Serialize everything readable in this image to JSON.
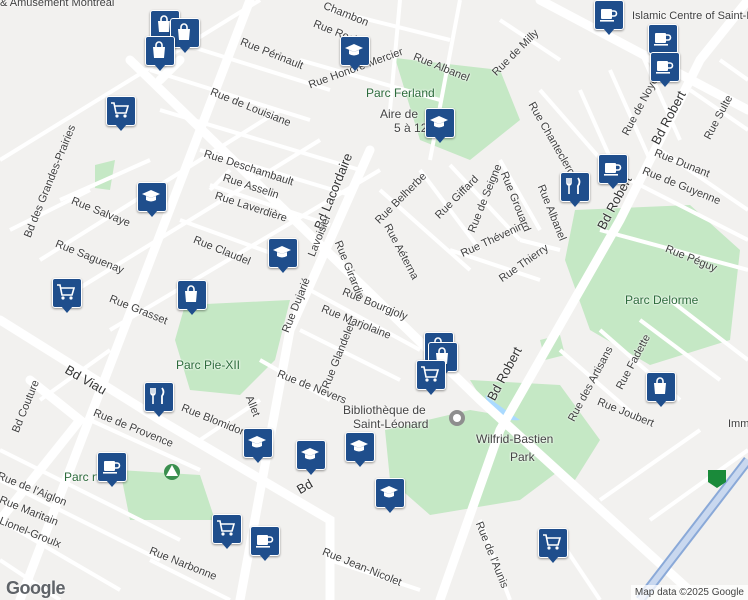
{
  "map": {
    "attribution": "Map data ©2025 Google",
    "logo": "Google",
    "colors": {
      "land": "#f2f1ef",
      "park": "#c5e8c5",
      "road": "#ffffff",
      "arterial": "#ffffff",
      "marker": "#1f4e8c",
      "water": "#aadaff"
    }
  },
  "labels": {
    "top_left_poi": "& Amusement Montreal",
    "islamic_centre": "Islamic Centre of Saint-Leonard",
    "rue_perinault": "Rue Périnault",
    "rue_roche": "Rue Roch",
    "rue_chambon": "Chambon",
    "rue_honore_mercier": "Rue Honoré-Mercier",
    "rue_albanel_top": "Rue Albanel",
    "rue_de_milly": "Rue de Milly",
    "parc_ferland": "Parc Ferland",
    "aire_de": "Aire de",
    "aire_ages": "5 à 12",
    "rue_de_louisiane": "Rue de Louisiane",
    "rue_deschambault": "Rue Deschambault",
    "rue_asselin": "Rue Asselin",
    "rue_laverdiere": "Rue Laverdière",
    "bd_lacordaire": "Bd Lacordaire",
    "rue_belherbe": "Rue Belherbe",
    "rue_giffard": "Rue Giffard",
    "rue_de_seigne": "Rue de Seigne",
    "rue_grouard": "Rue Grouard",
    "rue_thevenin": "Rue Thévenin",
    "rue_albanel_right": "Rue Albanel",
    "rue_thierry": "Rue Thierry",
    "rue_aeterna": "Rue Aéterna",
    "bd_des_grandes_prairies": "Bd des Grandes-Prairies",
    "rue_salvaye": "Rue Salvaye",
    "rue_saguenay": "Rue Saguenay",
    "bd_couture": "Bd Couture",
    "rue_claudel": "Rue Claudel",
    "rue_girardin": "Rue Girardin",
    "rue_lavoisier": "Lavoisier",
    "rue_dujarie": "Rue Dujarié",
    "rue_bourgjoly": "Rue Bourgjoly",
    "rue_marjolaine": "Rue Marjolaine",
    "rue_grasset": "Rue Grasset",
    "rue_glandelet": "Rue Glandelet",
    "rue_de_nevers": "Rue de Nevers",
    "parc_pie_xii": "Parc Pie-XII",
    "bd_viau": "Bd Viau",
    "rue_blomidon": "Rue Blomidon",
    "rue_de_provence": "Rue de Provence",
    "rue_de_laiglon": "Rue de l'Aiglon",
    "rue_maritain": "Rue Maritain",
    "rue_lionel_groulx": "Lionel-Groulx",
    "rue_narbonne": "Rue Narbonne",
    "rue_jean_nicolet": "Rue Jean-Nicolet",
    "bibliotheque_1": "Bibliothèque de",
    "bibliotheque_2": "Saint-Léonard",
    "wilfrid_1": "Wilfrid-Bastien",
    "wilfrid_2": "Park",
    "parc_delorme": "Parc Delorme",
    "rue_peguy": "Rue Péguy",
    "bd_robert_top": "Bd Robert",
    "bd_robert_mid": "Bd Robert",
    "bd_robert_bottom": "Bd Robert",
    "rue_de_guyenne": "Rue de Guyenne",
    "rue_dunant": "Rue Dunant",
    "rue_sulte": "Rue Sulte",
    "rue_de_noyelles": "Rue de Noyelles",
    "rue_chanteclerc": "Rue Chanteclerc",
    "rue_des_artisans": "Rue des Artisans",
    "rue_fadette": "Rue Fadette",
    "rue_joubert": "Rue Joubert",
    "rue_de_launis": "Rue de l'Aunis",
    "parc_martin": "Parc     rtin",
    "rue_bd_lacordaire_low": "Bd",
    "rue_allet": "Allet",
    "rue_imm": "Imm"
  },
  "markers": [
    {
      "icon": "shopping-bag-icon"
    },
    {
      "icon": "shopping-bag-icon"
    },
    {
      "icon": "shopping-bag-icon"
    },
    {
      "icon": "school-icon"
    },
    {
      "icon": "school-icon"
    },
    {
      "icon": "coffee-icon"
    },
    {
      "icon": "coffee-icon"
    },
    {
      "icon": "coffee-icon"
    },
    {
      "icon": "shopping-cart-icon"
    },
    {
      "icon": "school-icon"
    },
    {
      "icon": "restaurant-icon"
    },
    {
      "icon": "coffee-icon"
    },
    {
      "icon": "school-icon"
    },
    {
      "icon": "shopping-cart-icon"
    },
    {
      "icon": "shopping-bag-icon"
    },
    {
      "icon": "shopping-bag-icon"
    },
    {
      "icon": "shopping-bag-icon"
    },
    {
      "icon": "shopping-cart-icon"
    },
    {
      "icon": "restaurant-icon"
    },
    {
      "icon": "school-icon"
    },
    {
      "icon": "school-icon"
    },
    {
      "icon": "school-icon"
    },
    {
      "icon": "coffee-icon"
    },
    {
      "icon": "shopping-cart-icon"
    },
    {
      "icon": "coffee-icon"
    },
    {
      "icon": "shopping-cart-icon"
    },
    {
      "icon": "shopping-bag-icon"
    },
    {
      "icon": "school-icon"
    }
  ]
}
